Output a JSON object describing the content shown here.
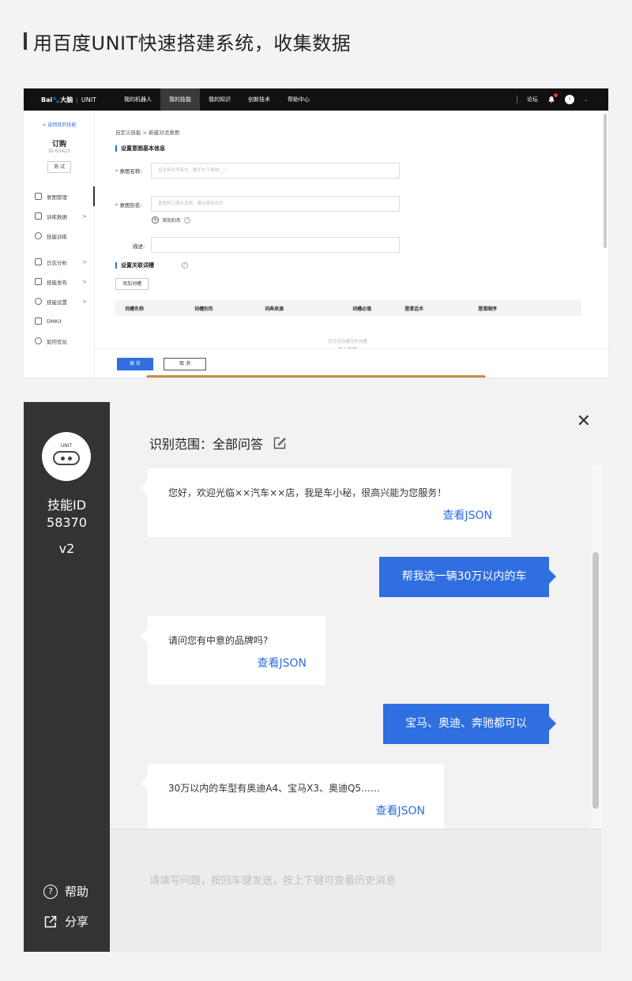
{
  "heading": "用百度UNIT快速搭建系统，收集数据",
  "shot1": {
    "logo": {
      "brand": "Bai",
      "brand2": "大脑",
      "product": "UNIT"
    },
    "nav": [
      "我的机器人",
      "我的技能",
      "我的知识",
      "创新技术",
      "帮助中心"
    ],
    "nav_right": {
      "forum": "论坛",
      "avatar": "I"
    },
    "side": {
      "back": "< 返回我的技能",
      "skill_name": "订购",
      "skill_id": "ID 63423",
      "test": "测 试",
      "menu": [
        {
          "label": "意图管理",
          "arrow": ""
        },
        {
          "label": "训练数据",
          "arrow": ">"
        },
        {
          "label": "技能训练",
          "arrow": ""
        },
        {
          "label": "日志分析",
          "arrow": ">"
        },
        {
          "label": "技能发布",
          "arrow": ">"
        },
        {
          "label": "技能设置",
          "arrow": ">"
        },
        {
          "label": "DMKit",
          "arrow": ""
        },
        {
          "label": "如何优化",
          "arrow": ""
        }
      ]
    },
    "main": {
      "crumb": "自定义技能  >  新建对话意图",
      "section1": "设置意图基本信息",
      "intent_name_label": "意图名称:",
      "intent_name_placeholder": "仅支持大写英文、数字与下划线\"_\"",
      "intent_alias_label": "意图别名:",
      "intent_alias_placeholder": "意图的口语化名称，建议使用中文",
      "add_alias": "添加别名",
      "desc_label": "描述:",
      "section2": "设置关联词槽",
      "add_slot": "添加词槽",
      "columns": [
        "词槽名称",
        "词槽别名",
        "词典来源",
        "词槽必填",
        "澄清话术",
        "澄清顺序"
      ],
      "empty_tip": "您还没创建任何词槽",
      "empty_link": "马上创建",
      "save": "保 存",
      "cancel": "取 消"
    }
  },
  "shot2": {
    "bot_label": "UNIT",
    "skill_id": "技能ID\n58370",
    "skill_id_line1": "技能ID",
    "skill_id_line2": "58370",
    "version": "v2",
    "help": "帮助",
    "share": "分享",
    "scope": "识别范围：全部问答",
    "messages": [
      {
        "role": "bot",
        "text": "您好，欢迎光临××汽车××店，我是车小秘，很高兴能为您服务！",
        "json": "查看JSON"
      },
      {
        "role": "user",
        "text": "帮我选一辆30万以内的车"
      },
      {
        "role": "bot",
        "text": "请问您有中意的品牌吗?",
        "json": "查看JSON"
      },
      {
        "role": "user",
        "text": "宝马、奥迪、奔驰都可以"
      },
      {
        "role": "bot",
        "text": "30万以内的车型有奥迪A4、宝马X3、奥迪Q5……",
        "json": "查看JSON"
      }
    ],
    "input_placeholder": "请填写问题，按回车键发送，按上下键可查看历史消息"
  },
  "colors": {
    "accent": "#2f6fe0",
    "nav": "#111111",
    "sidebar_dark": "#333333"
  }
}
